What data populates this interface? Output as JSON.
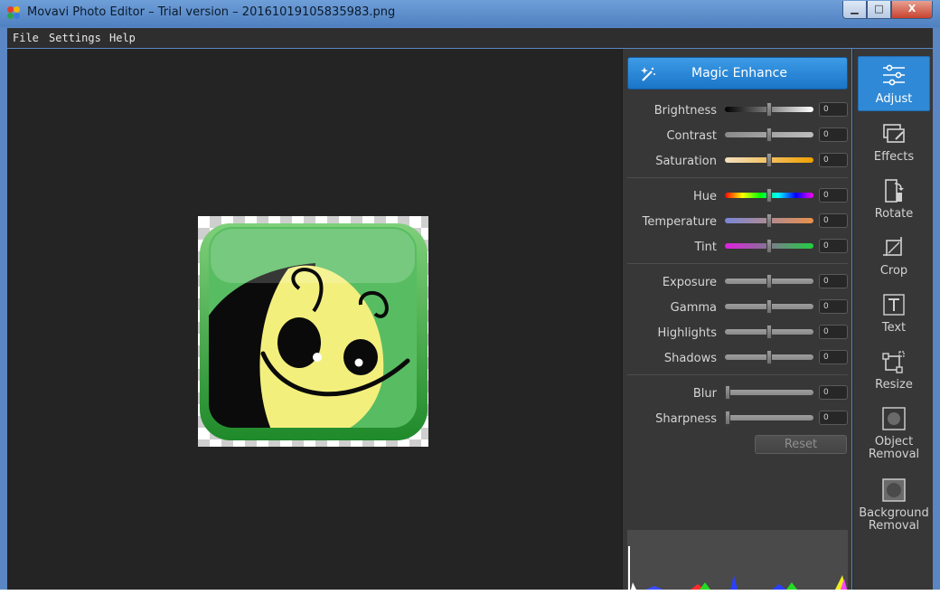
{
  "window": {
    "title": "Movavi Photo Editor – Trial version – 20161019105835983.png",
    "controls": {
      "minimize": "▁",
      "maximize": "□",
      "close": "X"
    }
  },
  "menu": [
    "File",
    "Settings",
    "Help"
  ],
  "panel": {
    "magic_enhance_label": "Magic Enhance",
    "groups": [
      [
        {
          "label": "Brightness",
          "value": "0"
        },
        {
          "label": "Contrast",
          "value": "0"
        },
        {
          "label": "Saturation",
          "value": "0"
        }
      ],
      [
        {
          "label": "Hue",
          "value": "0"
        },
        {
          "label": "Temperature",
          "value": "0"
        },
        {
          "label": "Tint",
          "value": "0"
        }
      ],
      [
        {
          "label": "Exposure",
          "value": "0"
        },
        {
          "label": "Gamma",
          "value": "0"
        },
        {
          "label": "Highlights",
          "value": "0"
        },
        {
          "label": "Shadows",
          "value": "0"
        }
      ],
      [
        {
          "label": "Blur",
          "value": "0"
        },
        {
          "label": "Sharpness",
          "value": "0"
        }
      ]
    ],
    "reset_label": "Reset"
  },
  "tools": [
    {
      "label": "Adjust",
      "icon": "adjust-icon",
      "active": true
    },
    {
      "label": "Effects",
      "icon": "effects-icon",
      "active": false
    },
    {
      "label": "Rotate",
      "icon": "rotate-icon",
      "active": false
    },
    {
      "label": "Crop",
      "icon": "crop-icon",
      "active": false
    },
    {
      "label": "Text",
      "icon": "text-icon",
      "active": false
    },
    {
      "label": "Resize",
      "icon": "resize-icon",
      "active": false
    },
    {
      "label": "Object Removal",
      "icon": "object-removal-icon",
      "active": false
    },
    {
      "label": "Background Removal",
      "icon": "background-removal-icon",
      "active": false
    }
  ],
  "colors": {
    "accent": "#2f89d6",
    "panel_bg": "#373737",
    "canvas_bg": "#242424"
  }
}
